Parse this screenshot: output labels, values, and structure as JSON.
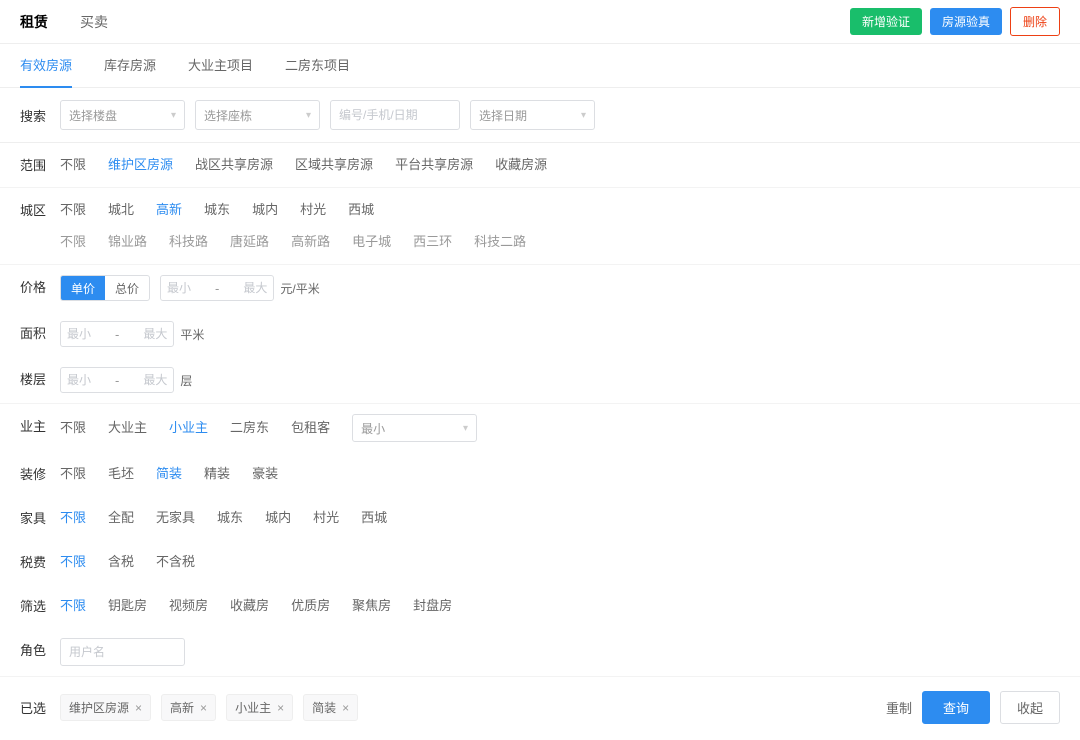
{
  "topTabs": {
    "rent": "租赁",
    "sale": "买卖"
  },
  "topButtons": {
    "newVerify": "新增验证",
    "sourceVerify": "房源验真",
    "delete": "删除"
  },
  "subTabs": {
    "valid": "有效房源",
    "stock": "库存房源",
    "bigOwnerProj": "大业主项目",
    "sublandlordProj": "二房东项目"
  },
  "search": {
    "label": "搜索",
    "building": "选择楼盘",
    "block": "选择座栋",
    "keyword_placeholder": "编号/手机/日期",
    "date": "选择日期"
  },
  "filters": {
    "scope": {
      "label": "范围",
      "opts": [
        "不限",
        "维护区房源",
        "战区共享房源",
        "区域共享房源",
        "平台共享房源",
        "收藏房源"
      ],
      "active": 1
    },
    "district": {
      "label": "城区",
      "opts": [
        "不限",
        "城北",
        "高新",
        "城东",
        "城内",
        "村光",
        "西城"
      ],
      "active": 2,
      "sub": [
        "不限",
        "锦业路",
        "科技路",
        "唐延路",
        "高新路",
        "电子城",
        "西三环",
        "科技二路"
      ]
    },
    "price": {
      "label": "价格",
      "unitPrice": "单价",
      "totalPrice": "总价",
      "min_placeholder": "最小",
      "max_placeholder": "最大",
      "unit": "元/平米"
    },
    "area": {
      "label": "面积",
      "min_placeholder": "最小",
      "max_placeholder": "最大",
      "unit": "平米"
    },
    "floor": {
      "label": "楼层",
      "min_placeholder": "最小",
      "max_placeholder": "最大",
      "unit": "层"
    },
    "owner": {
      "label": "业主",
      "opts": [
        "不限",
        "大业主",
        "小业主",
        "二房东",
        "包租客"
      ],
      "active": 2,
      "select_placeholder": "最小"
    },
    "deco": {
      "label": "装修",
      "opts": [
        "不限",
        "毛坯",
        "简装",
        "精装",
        "豪装"
      ],
      "active": 2
    },
    "furniture": {
      "label": "家具",
      "opts": [
        "不限",
        "全配",
        "无家具",
        "城东",
        "城内",
        "村光",
        "西城"
      ],
      "active": 0
    },
    "tax": {
      "label": "税费",
      "opts": [
        "不限",
        "含税",
        "不含税"
      ],
      "active": 0
    },
    "filter": {
      "label": "筛选",
      "opts": [
        "不限",
        "钥匙房",
        "视频房",
        "收藏房",
        "优质房",
        "聚焦房",
        "封盘房"
      ],
      "active": 0
    },
    "role": {
      "label": "角色",
      "placeholder": "用户名"
    }
  },
  "selected": {
    "label": "已选",
    "tags": [
      "维护区房源",
      "高新",
      "小业主",
      "简装"
    ]
  },
  "bottomButtons": {
    "reset": "重制",
    "query": "查询",
    "collapse": "收起"
  }
}
